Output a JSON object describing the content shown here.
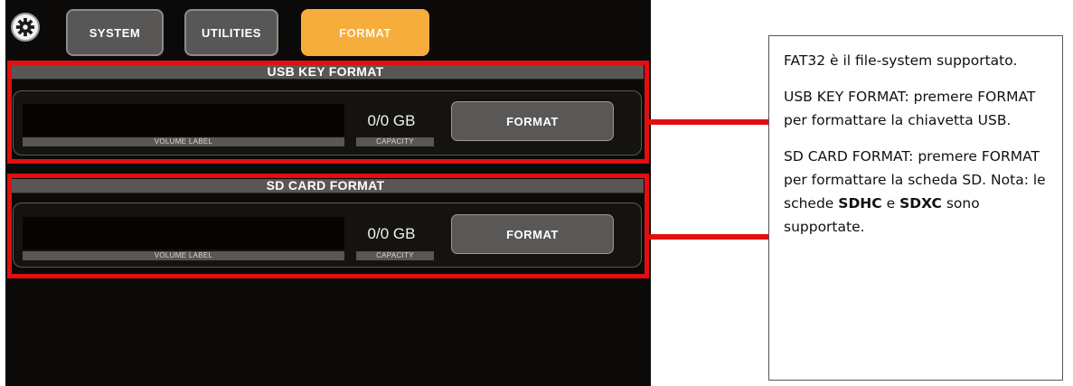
{
  "tabs": [
    {
      "label": "SYSTEM",
      "active": false
    },
    {
      "label": "UTILITIES",
      "active": false
    },
    {
      "label": "FORMAT",
      "active": true
    }
  ],
  "gear_icon": "gear-icon",
  "usb": {
    "title": "USB KEY FORMAT",
    "volume_label": "VOLUME LABEL",
    "capacity_value": "0/0 GB",
    "capacity_label": "CAPACITY",
    "button_label": "FORMAT"
  },
  "sd": {
    "title": "SD CARD FORMAT",
    "volume_label": "VOLUME LABEL",
    "capacity_value": "0/0 GB",
    "capacity_label": "CAPACITY",
    "button_label": "FORMAT"
  },
  "notes": {
    "p1": "FAT32 è il file-system supportato.",
    "p2": "USB KEY FORMAT: premere FORMAT per formattare la chiavetta USB.",
    "p3_text": "SD CARD FORMAT: premere FORMAT per formattare la scheda SD. Nota: le schede",
    "p3_bold1": "SDHC",
    "p3_mid": "e",
    "p3_bold2": "SDXC",
    "p3_end": "sono supportate."
  },
  "colors": {
    "accent": "#f6ad3c",
    "highlight": "#e10f0f",
    "panel": "#595653"
  }
}
